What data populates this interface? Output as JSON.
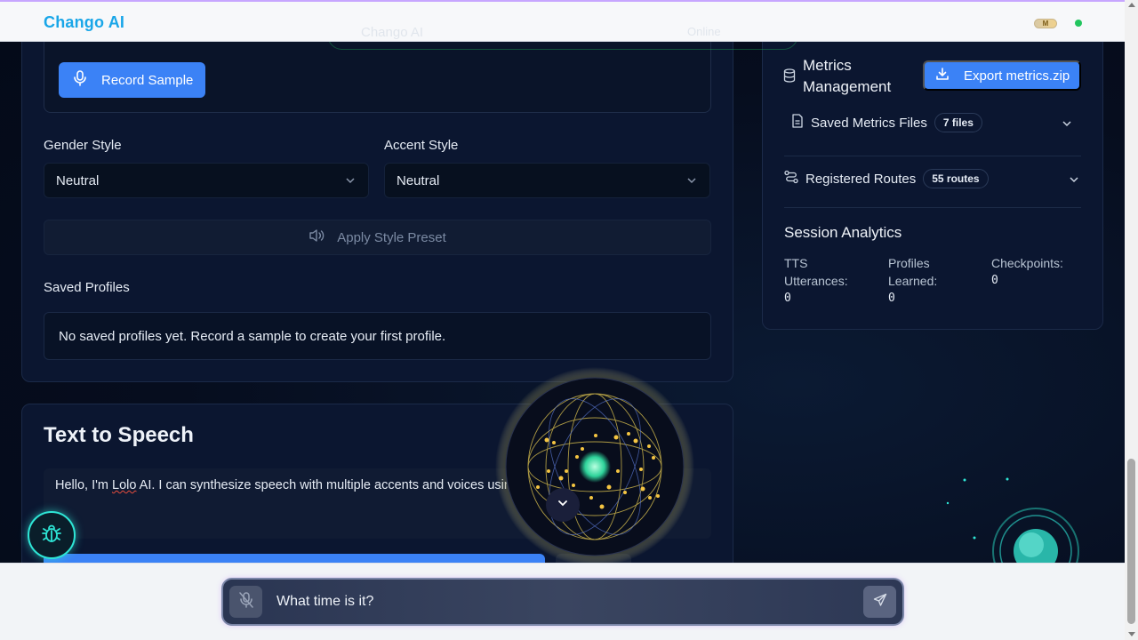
{
  "app": {
    "brand": "Chango AI",
    "badge": "M",
    "status_color": "#22c55e"
  },
  "ghost_header": {
    "title": "Chango AI",
    "status": "Online"
  },
  "voice_profile": {
    "record_button": "Record Sample",
    "gender_label": "Gender Style",
    "gender_value": "Neutral",
    "accent_label": "Accent Style",
    "accent_value": "Neutral",
    "preset_button": "Apply Style Preset",
    "saved_label": "Saved Profiles",
    "empty_message": "No saved profiles yet. Record a sample to create your first profile."
  },
  "tts": {
    "title": "Text to Speech",
    "text_before": "Hello, I'm ",
    "text_name": "Lolo",
    "text_after": " AI. I can synthesize speech with multiple accents and voices using our custom voice engine!"
  },
  "metrics": {
    "title": "Metrics Management",
    "export_button": "Export metrics.zip",
    "saved_files_label": "Saved Metrics Files",
    "saved_files_count": "7 files",
    "routes_label": "Registered Routes",
    "routes_count": "55 routes"
  },
  "analytics": {
    "title": "Session Analytics",
    "stats": [
      {
        "label": "TTS Utterances:",
        "value": "0"
      },
      {
        "label": "Profiles Learned:",
        "value": "0"
      },
      {
        "label": "Checkpoints:",
        "value": "0"
      }
    ]
  },
  "chat": {
    "placeholder": "",
    "value": "What time is it?"
  },
  "colors": {
    "accent": "#3b82f6",
    "brand": "#19a6e8",
    "debug_ring": "#2ee6d6"
  }
}
